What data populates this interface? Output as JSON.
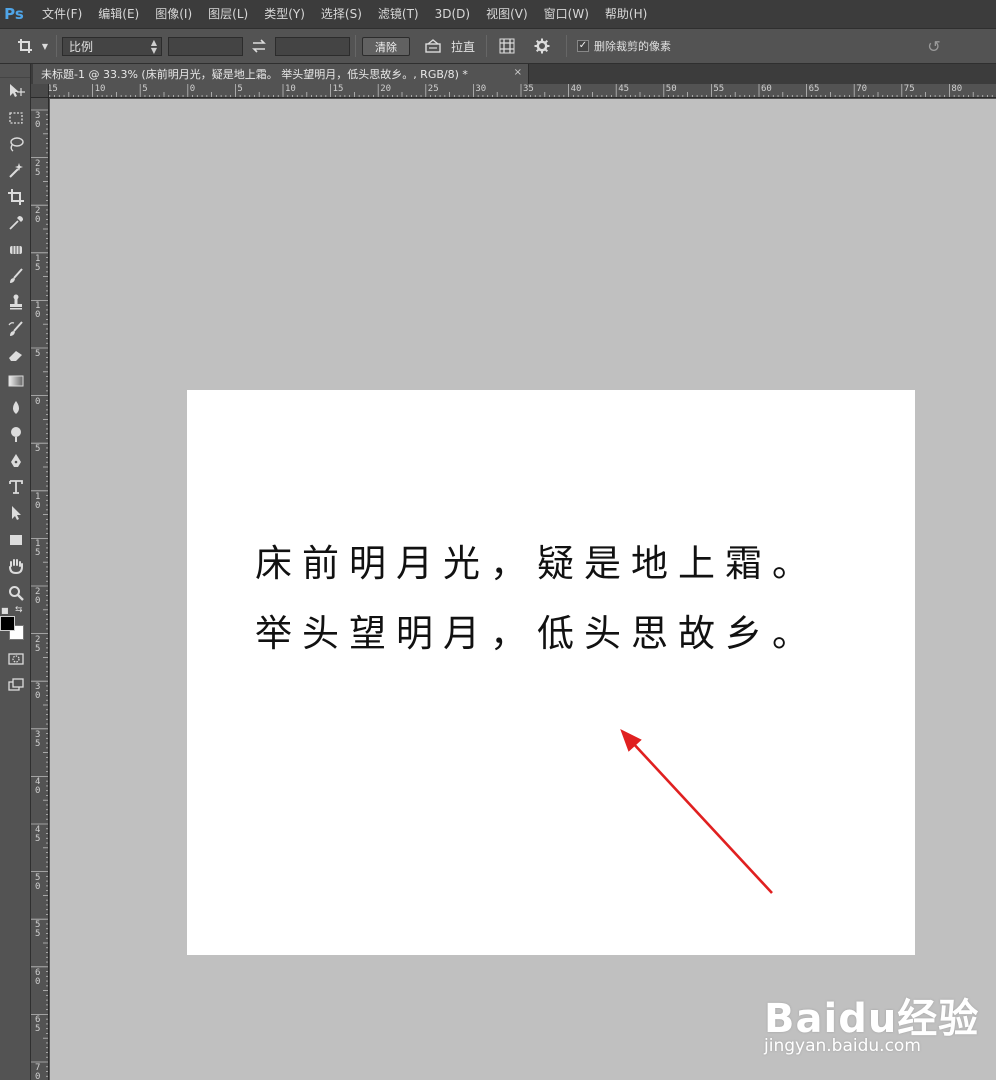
{
  "app": {
    "logo": "Ps",
    "menu": [
      "文件(F)",
      "编辑(E)",
      "图像(I)",
      "图层(L)",
      "类型(Y)",
      "选择(S)",
      "滤镜(T)",
      "3D(D)",
      "视图(V)",
      "窗口(W)",
      "帮助(H)"
    ]
  },
  "options_bar": {
    "ratio_select_value": "比例",
    "ratio_width_value": "",
    "ratio_height_value": "",
    "clear_label": "清除",
    "straighten_label": "拉直",
    "delete_cropped_label": "删除裁剪的像素",
    "delete_cropped_checked": true
  },
  "document": {
    "tab_title": "未标题-1 @ 33.3% (床前明月光，疑是地上霜。 举头望明月，低头思故乡。, RGB/8) *",
    "close_glyph": "×",
    "poem_line_1": "床前明月光，疑是地上霜。",
    "poem_line_2": "举头望明月，低头思故乡。"
  },
  "rulers": {
    "top_labels": [
      "15",
      "10",
      "5",
      "0",
      "5",
      "10",
      "15",
      "20",
      "25",
      "30",
      "35",
      "40",
      "45",
      "50",
      "55",
      "60",
      "65",
      "70",
      "75",
      "80"
    ],
    "left_labels": [
      "30",
      "25",
      "20",
      "15",
      "10",
      "5",
      "0",
      "5",
      "10",
      "15",
      "20",
      "25",
      "30",
      "35",
      "40",
      "45",
      "50",
      "55",
      "60",
      "65",
      "70"
    ]
  },
  "colors": {
    "foreground": "#000000",
    "background": "#ffffff",
    "arrow": "#e02020",
    "logo_blue": "#4fa5e8"
  },
  "watermark": {
    "logo": "Baidu经验",
    "url": "jingyan.baidu.com"
  }
}
